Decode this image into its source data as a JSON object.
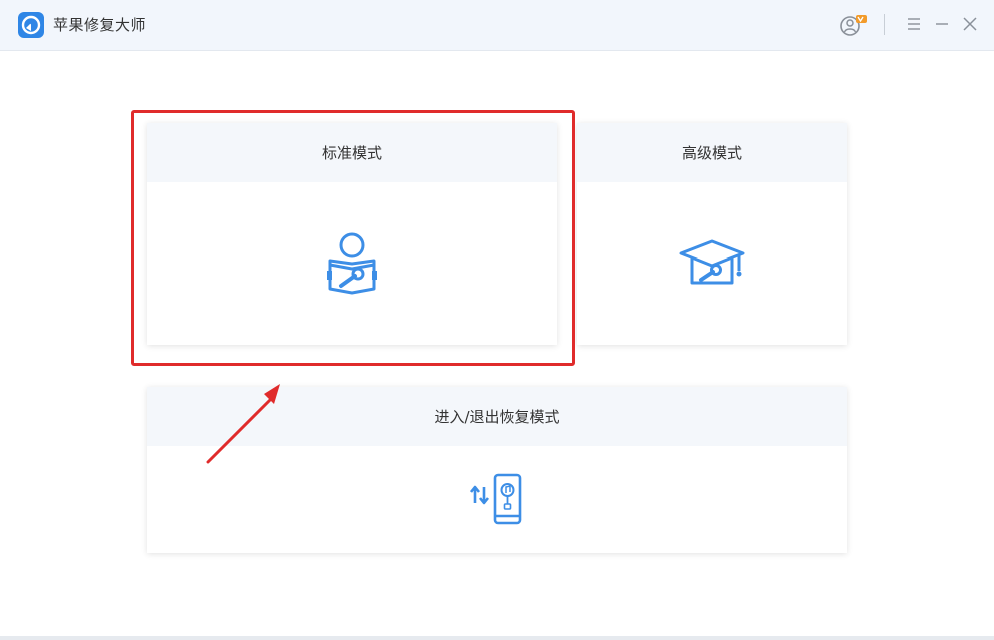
{
  "app": {
    "title": "苹果修复大师"
  },
  "modes": {
    "standard": {
      "label": "标准模式"
    },
    "advanced": {
      "label": "高级模式"
    },
    "recovery": {
      "label": "进入/退出恢复模式"
    }
  },
  "icons": {
    "app_logo": "app-logo-icon",
    "user": "user-vip-icon",
    "menu": "menu-icon",
    "minimize": "minimize-icon",
    "close": "close-icon",
    "standard": "person-repair-book-icon",
    "advanced": "graduation-cap-wrench-icon",
    "recovery": "phone-transfer-icon"
  },
  "colors": {
    "accent": "#3d8ee6",
    "titlebar_bg": "#f2f6fc",
    "card_header_bg": "#f4f7fb",
    "highlight": "#e02b2b",
    "vip_badge": "#f29b2b"
  }
}
